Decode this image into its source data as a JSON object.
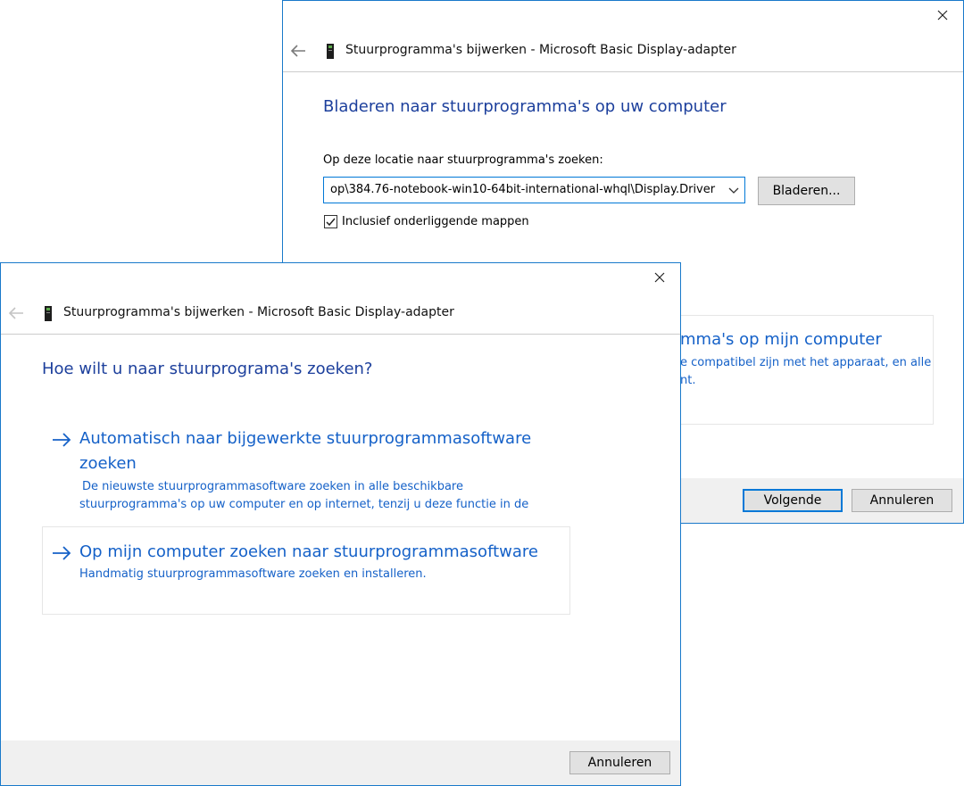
{
  "back_dialog": {
    "title": "Stuurprogramma's bijwerken - Microsoft Basic Display-adapter",
    "heading": "Bladeren naar stuurprogramma's op uw computer",
    "location_label": "Op deze locatie naar stuurprogramma's zoeken:",
    "path_value": "op\\384.76-notebook-win10-64bit-international-whql\\Display.Driver",
    "browse_button": "Bladeren...",
    "include_subfolders_label": "Inclusief onderliggende mappen",
    "include_subfolders_checked": true,
    "partial_option_title": "mma's op mijn computer",
    "partial_option_line1": "e compatibel zijn met het apparaat, en alle",
    "partial_option_line2": "nt.",
    "next_button": "Volgende",
    "cancel_button": "Annuleren"
  },
  "front_dialog": {
    "title": "Stuurprogramma's bijwerken - Microsoft Basic Display-adapter",
    "heading": "Hoe wilt u naar stuurprograma's zoeken?",
    "options": [
      {
        "title_line1": "Automatisch naar bijgewerkte stuurprogrammasoftware",
        "title_line2": "zoeken",
        "desc_line1": "De nieuwste stuurprogrammasoftware zoeken in alle beschikbare",
        "desc_line2": "stuurprogramma's op uw computer en op internet, tenzij u deze functie in de"
      },
      {
        "title_line1": "Op mijn computer zoeken naar stuurprogrammasoftware",
        "desc_line1": "Handmatig stuurprogrammasoftware zoeken en installeren."
      }
    ],
    "cancel_button": "Annuleren"
  },
  "colors": {
    "window_border": "#1979ca",
    "heading": "#1c3f9c",
    "link": "#1561c8",
    "footer_bg": "#f0f0f0",
    "focus_accent": "#0078d7"
  },
  "icons": {
    "back": "back-arrow-icon",
    "close": "close-icon",
    "device": "display-adapter-icon",
    "option_arrow": "right-arrow-icon",
    "dropdown": "chevron-down-icon",
    "check": "checkmark-icon"
  }
}
